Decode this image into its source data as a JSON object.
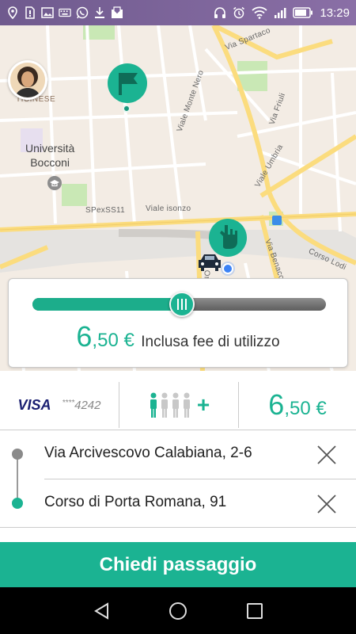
{
  "status_bar": {
    "time": "13:29",
    "left_icons": [
      "location-icon",
      "sim-alert-icon",
      "image-icon",
      "keyboard-icon",
      "whatsapp-icon",
      "download-icon",
      "inbox-icon"
    ],
    "right_icons": [
      "headset-icon",
      "alarm-icon",
      "wifi-icon",
      "signal-icon",
      "battery-icon"
    ]
  },
  "map": {
    "streets": {
      "via_spartaco": "Via Spartaco",
      "viale_monte_nero": "Viale Monte Nero",
      "via_friuli": "Via Friuli",
      "viale_umbria": "Viale Umbria",
      "spexss11": "SPexSS11",
      "viale_isonzo": "Viale isonzo",
      "via_benaco": "Via Benaco",
      "corso_lodi": "Corso Lodi",
      "via_ortles": "Via Or"
    },
    "district": "TICINESE",
    "poi": "Università\nBocconi"
  },
  "price_panel": {
    "slider_value": 0.51,
    "price_int": "6",
    "price_dec": ",50 €",
    "note": "Inclusa fee di utilizzo"
  },
  "payment": {
    "brand": "VISA",
    "masked_prefix": "****",
    "last4": "4242"
  },
  "passengers": {
    "selected": 1,
    "total": 4,
    "add_symbol": "+"
  },
  "fare": {
    "int": "6",
    "dec": ",50 €"
  },
  "route": {
    "from": "Via Arcivescovo Calabiana, 2-6",
    "to": "Corso di Porta Romana, 91"
  },
  "cta": {
    "label": "Chiedi passaggio"
  },
  "colors": {
    "accent": "#1bb392",
    "status_bar": "#7a629a",
    "visa_blue": "#1a1f71"
  }
}
